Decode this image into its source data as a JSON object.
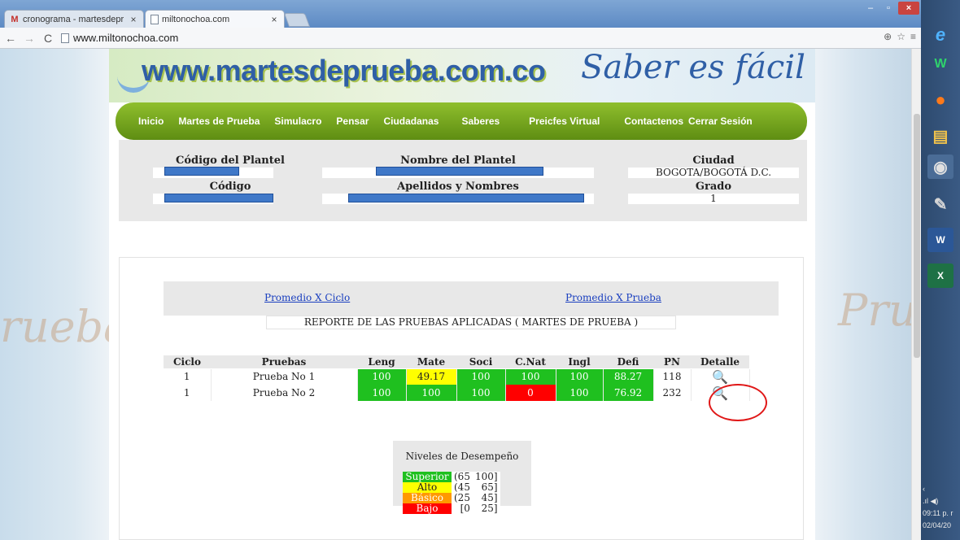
{
  "browser": {
    "tabs": [
      {
        "label": "cronograma - martesdepr",
        "icon": "gmail-icon"
      },
      {
        "label": "miltonochoa.com",
        "icon": "page-icon"
      }
    ],
    "url": "www.miltonochoa.com"
  },
  "taskbar": {
    "time": "09:11 p. r",
    "date": "02/04/20"
  },
  "banner": {
    "site": "www.martesdeprueba.com.co",
    "slogan": "Saber es fácil"
  },
  "nav": [
    "Inicio",
    "Martes de Prueba",
    "Simulacro",
    "Pensar",
    "Ciudadanas",
    "Saberes",
    "Preicfes Virtual",
    "Contactenos",
    "Cerrar Sesión"
  ],
  "info": {
    "codigo_plantel_label": "Código del Plantel",
    "nombre_plantel_label": "Nombre del Plantel",
    "ciudad_label": "Ciudad",
    "ciudad_value": "BOGOTA/BOGOTÁ D.C.",
    "codigo_label": "Código",
    "apellidos_label": "Apellidos y Nombres",
    "grado_label": "Grado",
    "grado_value": "1"
  },
  "report": {
    "promedio_ciclo": "Promedio X Ciclo",
    "promedio_prueba": "Promedio X Prueba",
    "title": "REPORTE DE LAS PRUEBAS APLICADAS ( MARTES DE PRUEBA )",
    "columns": [
      "Ciclo",
      "Pruebas",
      "Leng",
      "Mate",
      "Soci",
      "C.Nat",
      "Ingl",
      "Defi",
      "PN",
      "Detalle"
    ],
    "rows": [
      {
        "ciclo": "1",
        "prueba": "Prueba No 1",
        "leng": "100",
        "mate": "49.17",
        "soci": "100",
        "cnat": "100",
        "ingl": "100",
        "defi": "88.27",
        "pn": "118"
      },
      {
        "ciclo": "1",
        "prueba": "Prueba No 2",
        "leng": "100",
        "mate": "100",
        "soci": "100",
        "cnat": "0",
        "ingl": "100",
        "defi": "76.92",
        "pn": "232"
      }
    ]
  },
  "legend": {
    "title": "Niveles de Desempeño",
    "levels": [
      {
        "name": "Superior",
        "low": "(65",
        "high": "100]",
        "color": "#1fc01f"
      },
      {
        "name": "Alto",
        "low": "(45",
        "high": "65]",
        "color": "#ffff00"
      },
      {
        "name": "Básico",
        "low": "(25",
        "high": "45]",
        "color": "#ff9900"
      },
      {
        "name": "Bajo",
        "low": "[0",
        "high": "25]",
        "color": "#ff0000"
      }
    ]
  }
}
